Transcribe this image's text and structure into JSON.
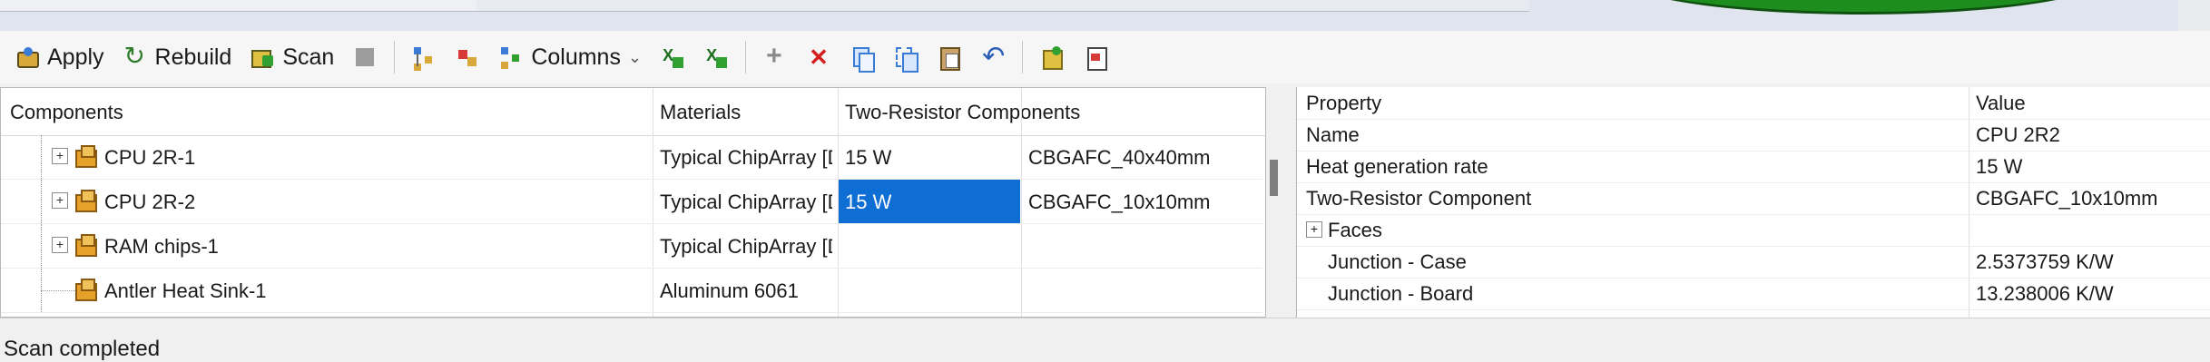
{
  "toolbar": {
    "apply_label": "Apply",
    "rebuild_label": "Rebuild",
    "scan_label": "Scan",
    "columns_label": "Columns",
    "icons": [
      "apply-icon",
      "rebuild-icon",
      "scan-icon",
      "stop-icon",
      "expand-tree-icon",
      "node-icon",
      "columns-icon",
      "excel-export-icon",
      "excel-import-icon",
      "add-icon",
      "delete-icon",
      "copy-icon",
      "copy-format-icon",
      "paste-icon",
      "undo-icon",
      "component-icon",
      "clipboard-icon"
    ]
  },
  "tree": {
    "headers": {
      "components": "Components",
      "materials": "Materials",
      "two_resistor": "Two-Resistor Components"
    },
    "rows": [
      {
        "name": "CPU 2R-1",
        "material": "Typical ChipArray [Du",
        "power": "15 W",
        "trc": "CBGAFC_40x40mm"
      },
      {
        "name": "CPU 2R-2",
        "material": "Typical ChipArray [Du",
        "power": "15 W",
        "trc": "CBGAFC_10x10mm"
      },
      {
        "name": "RAM chips-1",
        "material": "Typical ChipArray [Du",
        "power": "",
        "trc": ""
      },
      {
        "name": "Antler Heat Sink-1",
        "material": "Aluminum 6061",
        "power": "",
        "trc": ""
      }
    ]
  },
  "properties": {
    "headers": {
      "property": "Property",
      "value": "Value"
    },
    "rows": [
      {
        "name": "Name",
        "value": "CPU 2R2"
      },
      {
        "name": "Heat generation rate",
        "value": "15 W"
      },
      {
        "name": "Two-Resistor Component",
        "value": "CBGAFC_10x10mm"
      },
      {
        "name": "Faces",
        "value": ""
      },
      {
        "name": "Junction - Case",
        "value": "2.5373759 K/W"
      },
      {
        "name": "Junction - Board",
        "value": "13.238006 K/W"
      }
    ]
  },
  "status": {
    "text": "Scan completed"
  },
  "colors": {
    "selection": "#0f6ed4",
    "viewport_shape": "#1d8d1d"
  }
}
